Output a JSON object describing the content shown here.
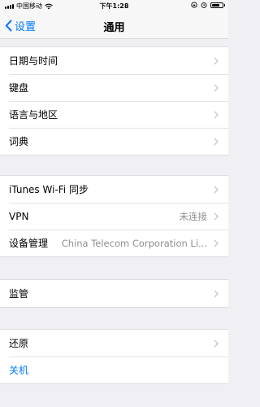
{
  "status_bar": {
    "carrier": "中国移动",
    "wifi_icon": "wifi-icon",
    "time": "下午1:28",
    "battery_level": 0.75
  },
  "nav": {
    "back_label": "设置",
    "title": "通用"
  },
  "groups": {
    "g1": [
      {
        "label": "日期与时间"
      },
      {
        "label": "键盘"
      },
      {
        "label": "语言与地区"
      },
      {
        "label": "词典"
      }
    ],
    "g2": [
      {
        "label": "iTunes Wi-Fi 同步"
      },
      {
        "label": "VPN",
        "value": "未连接"
      },
      {
        "label": "设备管理",
        "value": "China Telecom Corporation Li..."
      }
    ],
    "g3": [
      {
        "label": "监管"
      }
    ],
    "g4": [
      {
        "label": "还原"
      },
      {
        "label": "关机"
      }
    ]
  },
  "colors": {
    "accent": "#007aff",
    "background": "#efeff4",
    "secondary_text": "#8e8e93"
  }
}
